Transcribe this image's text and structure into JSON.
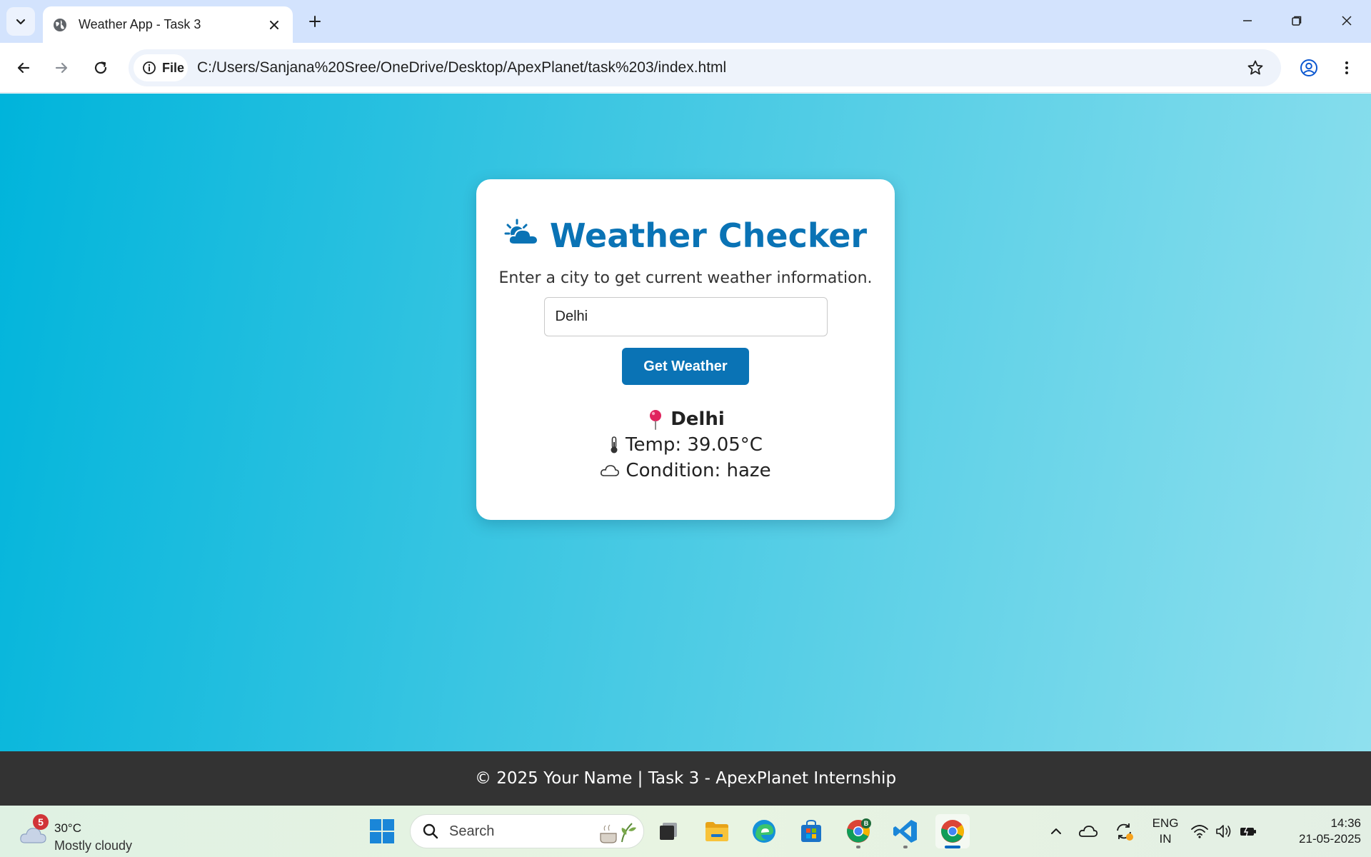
{
  "browser": {
    "tab_title": "Weather App - Task 3",
    "site_chip": "File",
    "url": "C:/Users/Sanjana%20Sree/OneDrive/Desktop/ApexPlanet/task%203/index.html"
  },
  "page": {
    "title_icon": "☁",
    "title": "Weather Checker",
    "subtitle": "Enter a city to get current weather information.",
    "city_input_value": "Delhi",
    "button_label": "Get Weather",
    "result": {
      "city": "Delhi",
      "temp": "Temp: 39.05°C",
      "condition": "Condition: haze"
    },
    "footer": "© 2025 Your Name | Task 3 - ApexPlanet Internship"
  },
  "taskbar": {
    "weather": {
      "badge": "5",
      "temp": "30°C",
      "condition": "Mostly cloudy"
    },
    "search_label": "Search",
    "lang_top": "ENG",
    "lang_bottom": "IN",
    "time": "14:36",
    "date": "21-05-2025",
    "profile_badge": "B"
  },
  "colors": {
    "accent": "#0a73b5",
    "tab_strip": "#d3e3fd",
    "gradient_start": "#00b4db",
    "gradient_end": "#8fe0ee",
    "footer_bg": "#333333"
  }
}
